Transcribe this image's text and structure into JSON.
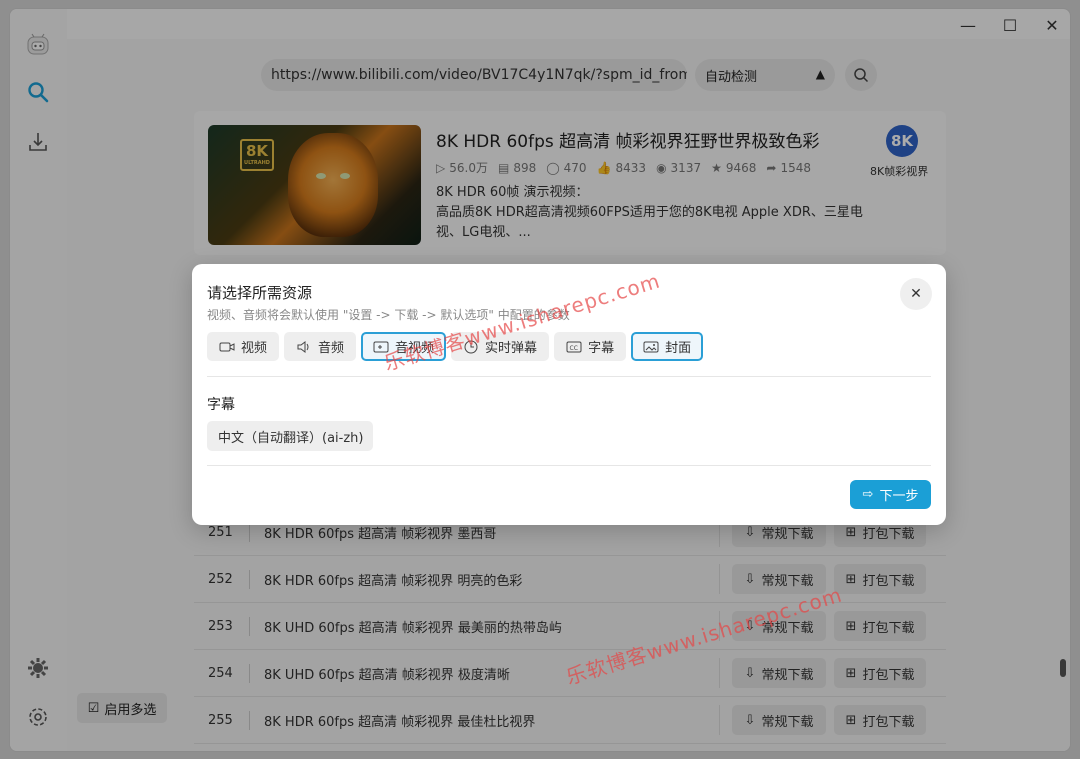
{
  "window": {
    "minimize": "—",
    "maximize": "☐",
    "close": "✕"
  },
  "search": {
    "url": "https://www.bilibili.com/video/BV17C4y1N7qk/?spm_id_from=33",
    "mode": "自动检测"
  },
  "video": {
    "thumb_badge": "8K",
    "thumb_badge_sub": "ULTRAHD",
    "title": "8K HDR 60fps 超高清 帧彩视界狂野世界极致色彩",
    "stats": {
      "views": "56.0万",
      "danmaku": "898",
      "comments": "470",
      "likes": "8433",
      "coins": "3137",
      "favorites": "9468",
      "shares": "1548"
    },
    "desc": "8K HDR 60帧 演示视频：\n高品质8K HDR超高清视频60FPS适用于您的8K电视 Apple XDR、三星电视、LG电视、...",
    "up_avatar": "8K",
    "up_name": "8K帧彩视界"
  },
  "list": {
    "rows": [
      {
        "num": "251",
        "title": "8K HDR 60fps 超高清 帧彩视界 墨西哥"
      },
      {
        "num": "252",
        "title": "8K HDR 60fps 超高清 帧彩视界 明亮的色彩"
      },
      {
        "num": "253",
        "title": "8K UHD 60fps 超高清 帧彩视界 最美丽的热带岛屿"
      },
      {
        "num": "254",
        "title": "8K UHD 60fps 超高清 帧彩视界 极度清晰"
      },
      {
        "num": "255",
        "title": "8K HDR 60fps 超高清 帧彩视界 最佳杜比视界"
      }
    ],
    "normal_download": "常规下载",
    "pack_download": "打包下载"
  },
  "multi_select": "启用多选",
  "dialog": {
    "title": "请选择所需资源",
    "subtitle": "视频、音频将会默认使用 \"设置 -> 下载 -> 默认选项\" 中配置的参数",
    "options": [
      {
        "label": "视频",
        "icon": "camera-icon",
        "selected": false
      },
      {
        "label": "音频",
        "icon": "speaker-icon",
        "selected": false
      },
      {
        "label": "音视频",
        "icon": "media-icon",
        "selected": true
      },
      {
        "label": "实时弹幕",
        "icon": "clock-icon",
        "selected": false
      },
      {
        "label": "字幕",
        "icon": "cc-icon",
        "selected": false
      },
      {
        "label": "封面",
        "icon": "image-icon",
        "selected": true
      }
    ],
    "section_title": "字幕",
    "subtitle_option": "中文（自动翻译）(ai-zh)",
    "next": "下一步"
  },
  "watermarks": [
    "乐软博客www.isharepc.com",
    "乐软博客www.isharepc.com"
  ],
  "colors": {
    "accent": "#1b9fd6",
    "selected_border": "#2a9fd6"
  }
}
